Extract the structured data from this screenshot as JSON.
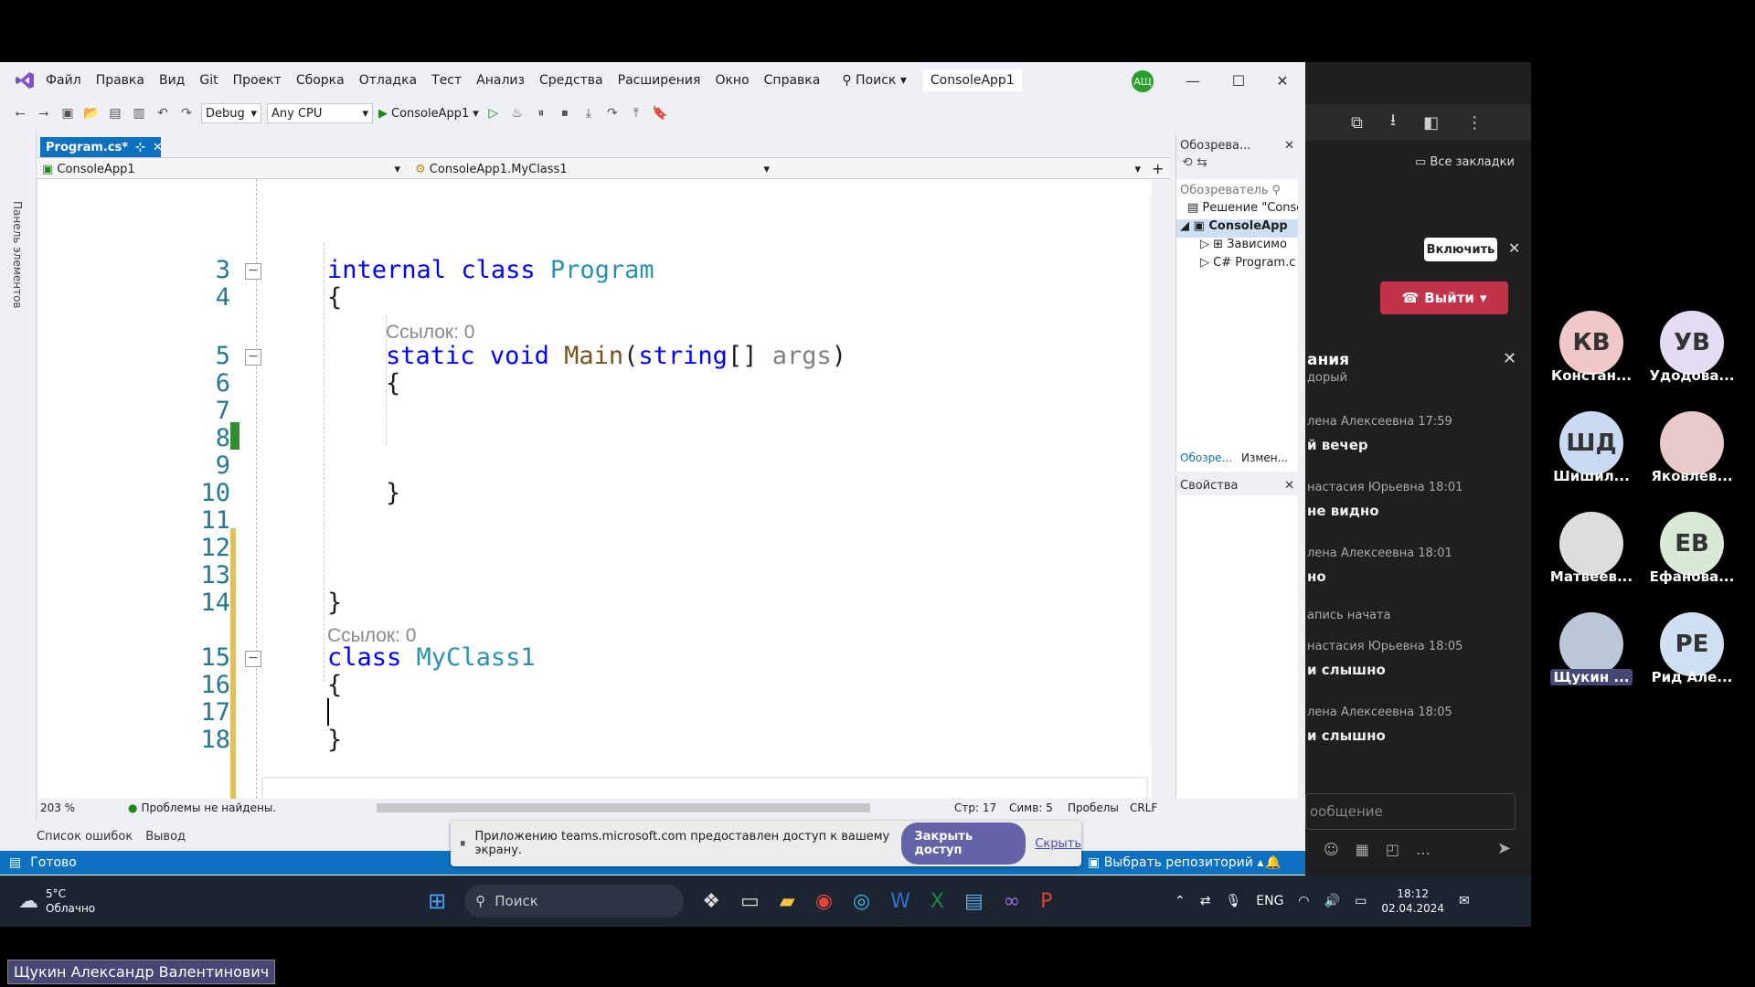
{
  "vs": {
    "menu": [
      "Файл",
      "Правка",
      "Вид",
      "Git",
      "Проект",
      "Сборка",
      "Отладка",
      "Тест",
      "Анализ",
      "Средства",
      "Расширения",
      "Окно",
      "Справка"
    ],
    "search_label": "Поиск",
    "window_title": "ConsoleApp1",
    "user_badge": "АЩ",
    "config": "Debug",
    "platform": "Any CPU",
    "run_target": "ConsoleApp1",
    "tab_label": "Program.cs*",
    "nav_project": "ConsoleApp1",
    "nav_class": "ConsoleApp1.MyClass1",
    "left_strip_label": "Панель элементов",
    "zoom": "203 %",
    "problems": "Проблемы не найдены.",
    "line_col": "Стр: 17",
    "char_col": "Симв: 5",
    "spaces": "Пробелы",
    "eol": "CRLF",
    "bottom_tabs": [
      "Список ошибок",
      "Вывод"
    ],
    "status_ready": "Готово",
    "repo": "Выбрать репозиторий",
    "explorer_title": "Обозрева...",
    "explorer_search": "Обозреватель",
    "solution_label": "Решение \"Conso",
    "project_label": "ConsoleApp",
    "deps_label": "Зависимо",
    "file_label": "Program.c",
    "explorer_tabs": [
      "Обозре...",
      "Измен..."
    ],
    "props_title": "Свойства"
  },
  "code": {
    "lines": [
      "3",
      "4",
      "5",
      "6",
      "7",
      "8",
      "9",
      "10",
      "11",
      "12",
      "13",
      "14",
      "15",
      "16",
      "17",
      "18"
    ],
    "refs": [
      "Ссылок: 0",
      "Ссылок: 0",
      "Ссылок: 0"
    ],
    "l3_kw1": "internal",
    "l3_kw2": "class",
    "l3_type": "Program",
    "l5_kw1": "static",
    "l5_kw2": "void",
    "l5_fn": "Main",
    "l5_kw3": "string",
    "l5_brackets": "[]",
    "l5_param": "args",
    "l15_kw": "class",
    "l15_type": "MyClass1",
    "open_brace": "{",
    "close_brace": "}",
    "open_paren": "(",
    "close_paren": ")"
  },
  "share": {
    "message": "Приложению teams.microsoft.com предоставлен доступ к вашему экрану.",
    "stop": "Закрыть доступ",
    "hide": "Скрыть"
  },
  "taskbar": {
    "temp": "5°C",
    "weather": "Облачно",
    "search": "Поиск",
    "lang": "ENG",
    "time": "18:12",
    "date": "02.04.2024"
  },
  "teams": {
    "bookmarks": "Все закладки",
    "enable": "Включить",
    "leave": "Выйти",
    "chat_title": "ания",
    "chat": [
      {
        "meta": "дорый",
        "msg": ""
      },
      {
        "meta": "лена Алексеевна  17:59",
        "msg": "й вечер"
      },
      {
        "meta": "настасия Юрьевна  18:01",
        "msg": "не видно"
      },
      {
        "meta": "лена Алексеевна  18:01",
        "msg": "но"
      },
      {
        "meta": "апись начата",
        "msg": ""
      },
      {
        "meta": "настасия Юрьевна  18:05",
        "msg": "и слышно"
      },
      {
        "meta": "лена Алексеевна  18:05",
        "msg": "и слышно"
      }
    ],
    "compose": "ообщение",
    "participants": [
      {
        "initials": "КВ",
        "name": "Констан...",
        "color": "#f2c7c7"
      },
      {
        "initials": "УВ",
        "name": "Удодова...",
        "color": "#e3dcf2"
      },
      {
        "initials": "ШД",
        "name": "Шишил...",
        "color": "#c9dbf2"
      },
      {
        "initials": "",
        "name": "Яковлев...",
        "color": "#e9c9c9"
      },
      {
        "initials": "",
        "name": "Матвеев...",
        "color": "#ddd"
      },
      {
        "initials": "ЕВ",
        "name": "Ефанова...",
        "color": "#d8e9d6"
      },
      {
        "initials": "",
        "name": "Щукин ...",
        "color": "#b9c7d8"
      },
      {
        "initials": "РЕ",
        "name": "Рид Але...",
        "color": "#cfe0f2"
      }
    ],
    "presenter": "Щукин Александр Валентинович"
  }
}
